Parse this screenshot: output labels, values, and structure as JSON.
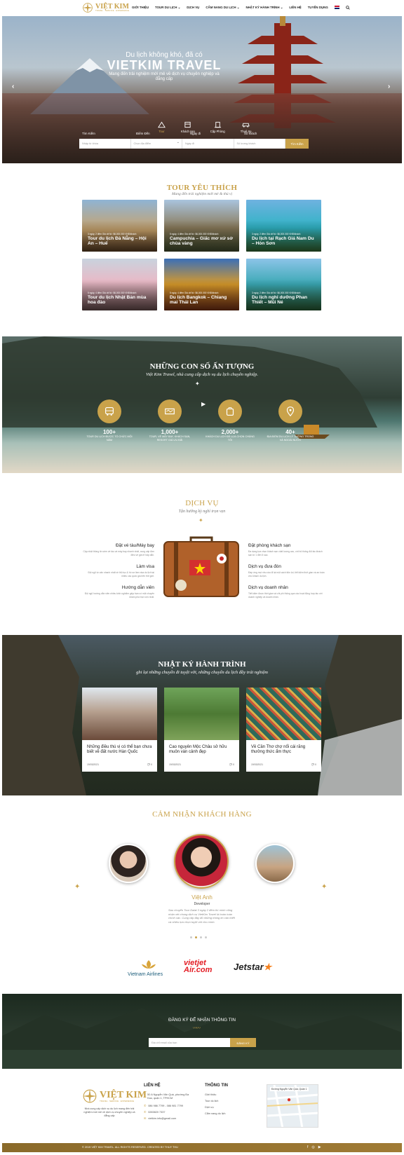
{
  "brand": {
    "name": "VIỆT KIM",
    "tagline": "TRAVEL · SERVICE · EXPERIENCE"
  },
  "nav": {
    "items": [
      "GIỚI THIỆU",
      "TOUR DU LỊCH ⌄",
      "DỊCH VỤ",
      "CẨM NANG DU LỊCH ⌄",
      "NHẬT KÝ HÀNH TRÌNH ⌄",
      "LIÊN HỆ",
      "TUYỂN DỤNG"
    ]
  },
  "hero": {
    "line1": "Du lịch không khó, đã có",
    "line2": "VIETKIM TRAVEL",
    "sub": "Mang đến trải nghiệm mới mẻ về dịch vụ chuyên nghiệp và đẳng cấp",
    "tabs": [
      {
        "label": "Tour"
      },
      {
        "label": "Khách sạn"
      },
      {
        "label": "Cặp Phòng"
      },
      {
        "label": "Thuê Xe"
      }
    ],
    "search": {
      "labels": [
        "Tìm Kiếm",
        "Điểm Đến",
        "Ngày đi",
        "Số khách"
      ],
      "placeholders": [
        "Nhập từ khóa",
        "Chọn địa điểm",
        "Ngày đi",
        "Số lượng khách"
      ],
      "button": "Tìm Kiếm"
    }
  },
  "tours": {
    "title": "TOUR YÊU THÍCH",
    "sub": "Mang đến trải nghiệm mới mẻ & thú vị",
    "items": [
      {
        "meta": "3 ngày, 2 đêm   Giá chỉ từ: $6,000.000 VNĐ/khách",
        "name": "Tour du lịch Đà Nẵng – Hội An – Huế"
      },
      {
        "meta": "5 ngày, 4 đêm   Giá chỉ từ: $6,000.000 VNĐ/khách",
        "name": "Campuchia – Giấc mơ xứ sở chùa vàng"
      },
      {
        "meta": "3 ngày, 2 đêm   Giá chỉ từ: $6,000.000 VNĐ/khách",
        "name": "Du lịch tại Rạch Giá Nam Du – Hòn Sơn"
      },
      {
        "meta": "5 ngày, 4 đêm   Giá chỉ từ: $6,000.000 VNĐ/khách",
        "name": "Tour du lịch Nhật Bản mùa hoa đào"
      },
      {
        "meta": "5 ngày, 4 đêm   Giá chỉ từ: $6,000.000 VNĐ/khách",
        "name": "Du lịch Bangkok – Chiang mai Thái Lan"
      },
      {
        "meta": "3 ngày, 2 đêm   Giá chỉ từ: $6,000.000 VNĐ/khách",
        "name": "Du lịch nghỉ dưỡng Phan Thiết – Mũi Né"
      }
    ]
  },
  "stats": {
    "title": "NHỮNG CON SỐ ẤN TƯỢNG",
    "sub": "Việt Kim Travel, nhà cung cấp dịch vụ du lịch chuyên nghiệp.",
    "items": [
      {
        "num": "100+",
        "label": "TOUR DU LỊCH ĐƯỢC TỔ CHỨC MỖI NĂM"
      },
      {
        "num": "1,000+",
        "label": "TOUR, VÉ MÁY BAY, KHÁCH SẠN, RESORT GIÁ ƯU ĐÃI"
      },
      {
        "num": "2,000+",
        "label": "KHÁCH DU LỊCH ĐÃ LỰA CHỌN CHÚNG TÔI"
      },
      {
        "num": "40+",
        "label": "ĐỊA ĐIỂM DU LỊCH LÝ TƯỞNG TRONG VÀ NGOÀI NƯỚC"
      }
    ]
  },
  "services": {
    "title": "DỊCH VỤ",
    "sub": "Tận hưởng kỳ nghỉ trọn vẹn",
    "left": [
      {
        "h": "Đặt vé tàu/Máy bay",
        "t": "Cập nhật thông tin sớm về tàu và máy bay nhanh nhất, cung cấp đơn điều vé giá rẻ hấp dẫn."
      },
      {
        "h": "Làm visa",
        "t": "Đội ngũ tư vấn nhanh nhất về thủ tục & hồ sơ làm visa du lịch tại nhiều các quốc gia trên thế giới."
      },
      {
        "h": "Hướng dẫn viên",
        "t": "Đội ngũ hướng dẫn viên nhiều kinh nghiệm giúp bạn có một chuyến khám phá trọn vẹn nhất."
      }
    ],
    "right": [
      {
        "h": "Đặt phòng khách sạn",
        "t": "Đa dạng lựa chọn khách sạn chất lượng cao, với hệ thống đối tác khách sạn từ 1 đến 5 sao."
      },
      {
        "h": "Dịch vụ đưa đón",
        "t": "Đáp ứng mọi nhu cầu đi lại một cách tiện lợi, tiết kiệm thời gian và an toàn cho khách du lịch."
      },
      {
        "h": "Dịch vụ doanh nhân",
        "t": "Tiết kiệm được thời gian và chi phí thông qua các hoạt động hợp tác với doanh nghiệp và doanh nhân."
      }
    ]
  },
  "journal": {
    "title": "NHẬT KÝ HÀNH TRÌNH",
    "sub": "ghi lại những chuyến đi tuyệt vời, những chuyến du lịch đầy trải nghiệm",
    "items": [
      {
        "title": "Những điều thú vị có thể bạn chưa biết về đất nước Hàn Quốc",
        "date": "19/03/2021",
        "comments": "0"
      },
      {
        "title": "Cao nguyên Mộc Châu sở hữu muôn vàn cảnh đẹp",
        "date": "19/03/2021",
        "comments": "0"
      },
      {
        "title": "Về Cần Thơ chợ nổi cái răng thưởng thức ẩm thực",
        "date": "19/03/2021",
        "comments": "0"
      }
    ]
  },
  "testimonials": {
    "title": "CẢM NHẬN KHÁCH HÀNG",
    "name": "Việt Anh",
    "role": "Developer",
    "quote": "Sau chuyến Tour Dalat 3 ngày 2 đêm thì mình cũng nhận xét chung dịch vụ VietKim Travel là hoàn toàn chính xác. Cung cấp đầy đủ những thông tin cần thiết và nhiều lựa chọn tuyệt vời cho mình."
  },
  "partners": [
    "Vietnam Airlines",
    "vietjet Air.com",
    "Jetstar"
  ],
  "newsletter": {
    "title": "ĐĂNG KÝ ĐỂ NHẬN THÔNG TIN",
    "placeholder": "Địa chỉ email của bạn",
    "button": "ĐĂNG KÝ"
  },
  "footer": {
    "desc": "Nhà cung cấp dịch vụ du lịch mang đến trải nghiệm mới mẻ về dịch vụ chuyên nghiệp và đẳng cấp",
    "contact_head": "LIÊN HỆ",
    "contact": [
      "50 A Nguyễn Văn Quá, phường Đa Kao, quận 1, TPHCM",
      "086 986 7799 - 086 981 7799",
      "0283820 7337",
      "vietkim.info@gmail.com"
    ],
    "info_head": "THÔNG TIN",
    "info": [
      "Giới thiệu",
      "Tour du lịch",
      "Dịch vụ",
      "Cẩm nang du lịch"
    ],
    "map_label": "Đường Nguyễn Văn Quá, Quận 1",
    "copyright": "© 2019 VIỆT KIM TRAVEL. ALL RIGHTS RESERVED. CREATED BY THUY THU"
  },
  "colors": {
    "accent": "#c9a24a",
    "footer_bar": "#8a6a2a"
  }
}
